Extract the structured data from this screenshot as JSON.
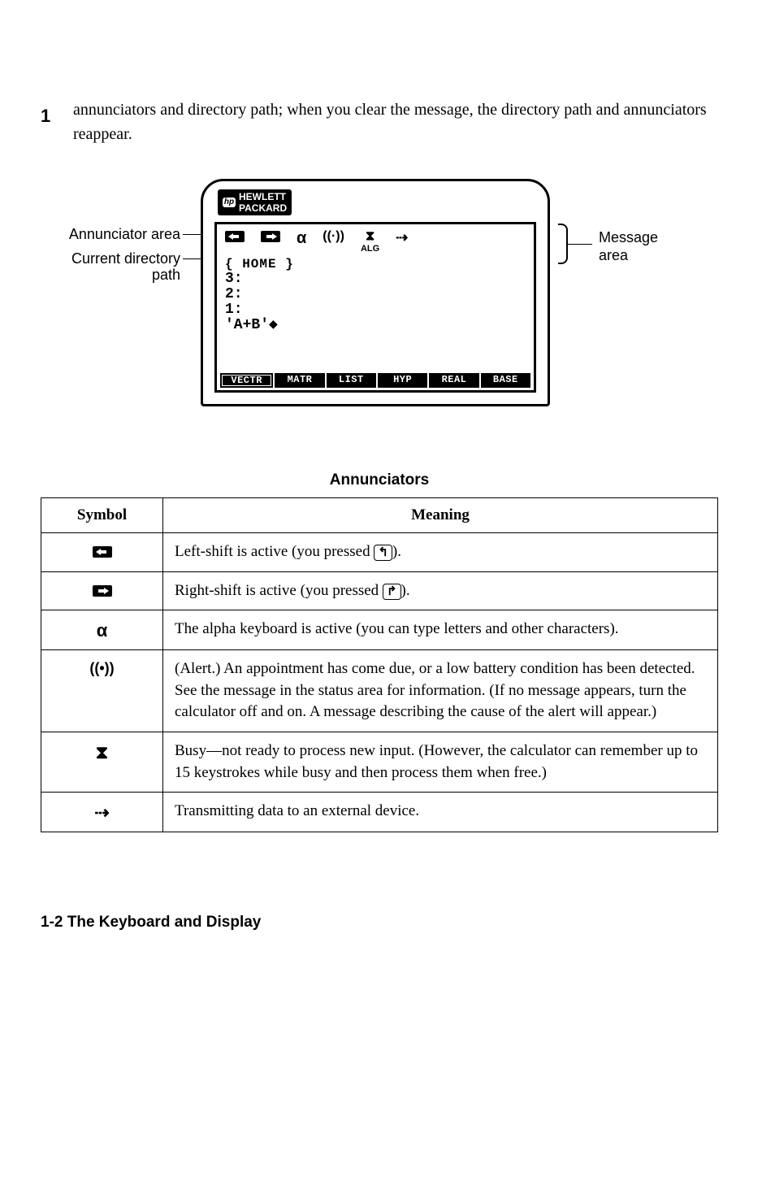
{
  "page_number": "1",
  "intro_text": "annunciators and directory path; when you clear the message, the directory path and annunciators reappear.",
  "diagram": {
    "brand_line1": "HEWLETT",
    "brand_line2": "PACKARD",
    "callout_annunciator": "Annunciator area",
    "callout_dir1": "Current directory",
    "callout_dir2": "path",
    "callout_msg1": "Message",
    "callout_msg2": "area",
    "annunciators": {
      "alpha": "α",
      "alert": "((·))",
      "busy": "⧗",
      "alg": "ALG",
      "tx": "⇢"
    },
    "dir_path": "{ HOME }",
    "stack_lines": [
      "3:",
      "2:",
      "1:",
      "'A+B'◆"
    ],
    "menu": [
      "VECTR",
      "MATR",
      "LIST",
      "HYP",
      "REAL",
      "BASE"
    ]
  },
  "table": {
    "title": "Annunciators",
    "head_symbol": "Symbol",
    "head_meaning": "Meaning",
    "rows": [
      {
        "symbol_type": "shift-left",
        "meaning_pre": "Left-shift is active (you pressed ",
        "key_glyph": "↰",
        "meaning_post": ")."
      },
      {
        "symbol_type": "shift-right",
        "meaning_pre": "Right-shift is active (you pressed ",
        "key_glyph": "↱",
        "meaning_post": ")."
      },
      {
        "symbol_text": "α",
        "meaning": "The alpha keyboard is active (you can type letters and other characters)."
      },
      {
        "symbol_text": "((•))",
        "meaning": "(Alert.) An appointment has come due, or a low battery condition has been detected. See the message in the status area for information. (If no message appears, turn the calculator off and on. A message describing the cause of the alert will appear.)"
      },
      {
        "symbol_text": "⧗",
        "meaning": "Busy—not ready to process new input. (However, the calculator can remember up to 15 keystrokes while busy and then process them when free.)"
      },
      {
        "symbol_text": "⇢",
        "meaning": "Transmitting data to an external device."
      }
    ]
  },
  "footer": "1-2   The Keyboard and Display"
}
